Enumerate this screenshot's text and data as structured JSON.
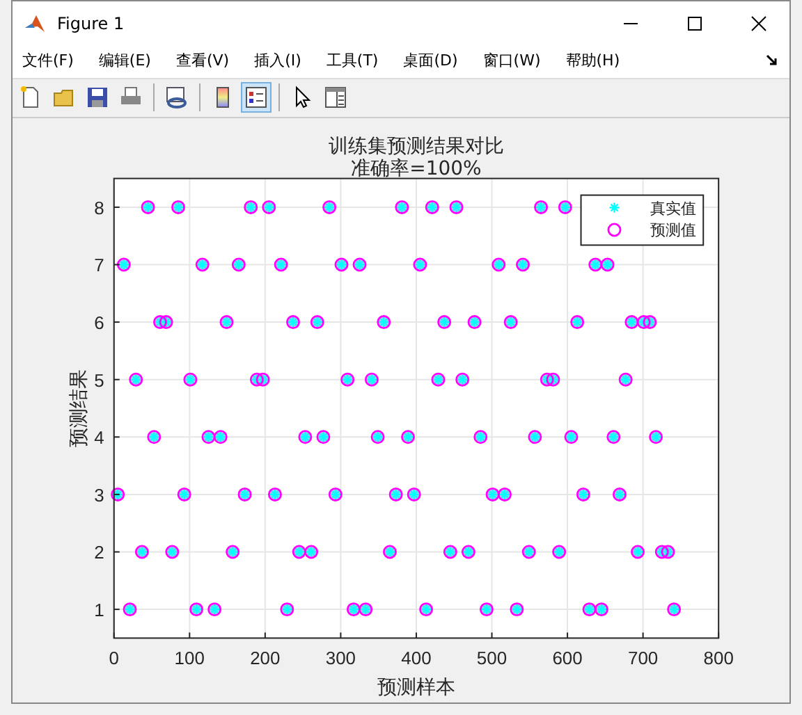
{
  "window": {
    "title": "Figure 1"
  },
  "menu": [
    {
      "label": "文件(F)"
    },
    {
      "label": "编辑(E)"
    },
    {
      "label": "查看(V)"
    },
    {
      "label": "插入(I)"
    },
    {
      "label": "工具(T)"
    },
    {
      "label": "桌面(D)"
    },
    {
      "label": "窗口(W)"
    },
    {
      "label": "帮助(H)"
    }
  ],
  "toolbar": [
    {
      "kind": "new",
      "selected": false
    },
    {
      "kind": "open",
      "selected": false
    },
    {
      "kind": "save",
      "selected": false
    },
    {
      "kind": "print",
      "selected": false
    },
    {
      "kind": "sep"
    },
    {
      "kind": "link",
      "selected": false
    },
    {
      "kind": "sep"
    },
    {
      "kind": "colorbar",
      "selected": false
    },
    {
      "kind": "legend",
      "selected": true
    },
    {
      "kind": "sep"
    },
    {
      "kind": "pointer",
      "selected": false
    },
    {
      "kind": "inspector",
      "selected": false
    }
  ],
  "figure": {
    "chart_data": {
      "type": "scatter",
      "title": "训练集预测结果对比",
      "subtitle": "准确率=100%",
      "grid": true,
      "legend": true,
      "xlabel": "预测样本",
      "ylabel": "预测结果",
      "x": [
        5,
        13,
        21,
        29,
        37,
        45,
        53,
        61,
        69,
        77,
        85,
        93,
        101,
        109,
        117,
        125,
        133,
        141,
        149,
        157,
        165,
        173,
        181,
        189,
        197,
        205,
        213,
        221,
        229,
        237,
        245,
        253,
        261,
        269,
        277,
        285,
        293,
        301,
        309,
        317,
        325,
        333,
        341,
        349,
        357,
        365,
        373,
        381,
        389,
        397,
        405,
        413,
        421,
        429,
        437,
        445,
        453,
        461,
        469,
        477,
        485,
        493,
        501,
        509,
        517,
        525,
        533,
        541,
        549,
        557,
        565,
        573,
        581,
        589,
        597,
        605,
        613,
        621,
        629,
        637,
        645,
        653,
        661,
        669,
        677,
        685,
        693,
        701,
        709,
        717,
        725,
        733,
        741
      ],
      "series": [
        {
          "name": "真实值",
          "color": "#00ffff",
          "marker": "cross",
          "values": [
            3,
            7,
            1,
            5,
            2,
            8,
            4,
            6,
            6,
            2,
            8,
            3,
            5,
            1,
            7,
            4,
            1,
            4,
            6,
            2,
            7,
            3,
            8,
            5,
            5,
            8,
            3,
            7,
            1,
            6,
            2,
            4,
            2,
            6,
            4,
            8,
            3,
            7,
            5,
            1,
            7,
            1,
            5,
            4,
            6,
            2,
            3,
            8,
            4,
            3,
            7,
            1,
            8,
            5,
            6,
            2,
            8,
            5,
            2,
            6,
            4,
            1,
            3,
            7,
            3,
            6,
            1,
            7,
            2,
            4,
            8,
            5,
            5,
            2,
            8,
            4,
            6,
            3,
            1,
            7,
            1,
            7,
            4,
            3,
            5,
            6,
            2,
            6,
            6,
            4,
            2,
            2,
            1
          ]
        },
        {
          "name": "预测值",
          "color": "#ff00ff",
          "marker": "circle",
          "values": [
            3,
            7,
            1,
            5,
            2,
            8,
            4,
            6,
            6,
            2,
            8,
            3,
            5,
            1,
            7,
            4,
            1,
            4,
            6,
            2,
            7,
            3,
            8,
            5,
            5,
            8,
            3,
            7,
            1,
            6,
            2,
            4,
            2,
            6,
            4,
            8,
            3,
            7,
            5,
            1,
            7,
            1,
            5,
            4,
            6,
            2,
            3,
            8,
            4,
            3,
            7,
            1,
            8,
            5,
            6,
            2,
            8,
            5,
            2,
            6,
            4,
            1,
            3,
            7,
            3,
            6,
            1,
            7,
            2,
            4,
            8,
            5,
            5,
            2,
            8,
            4,
            6,
            3,
            1,
            7,
            1,
            7,
            4,
            3,
            5,
            6,
            2,
            6,
            6,
            4,
            2,
            2,
            1
          ]
        }
      ],
      "xlim": [
        0,
        800
      ],
      "ylim": [
        0.5,
        8.5
      ],
      "xticks": [
        0,
        100,
        200,
        300,
        400,
        500,
        600,
        700,
        800
      ],
      "yticks": [
        1,
        2,
        3,
        4,
        5,
        6,
        7,
        8
      ]
    }
  }
}
